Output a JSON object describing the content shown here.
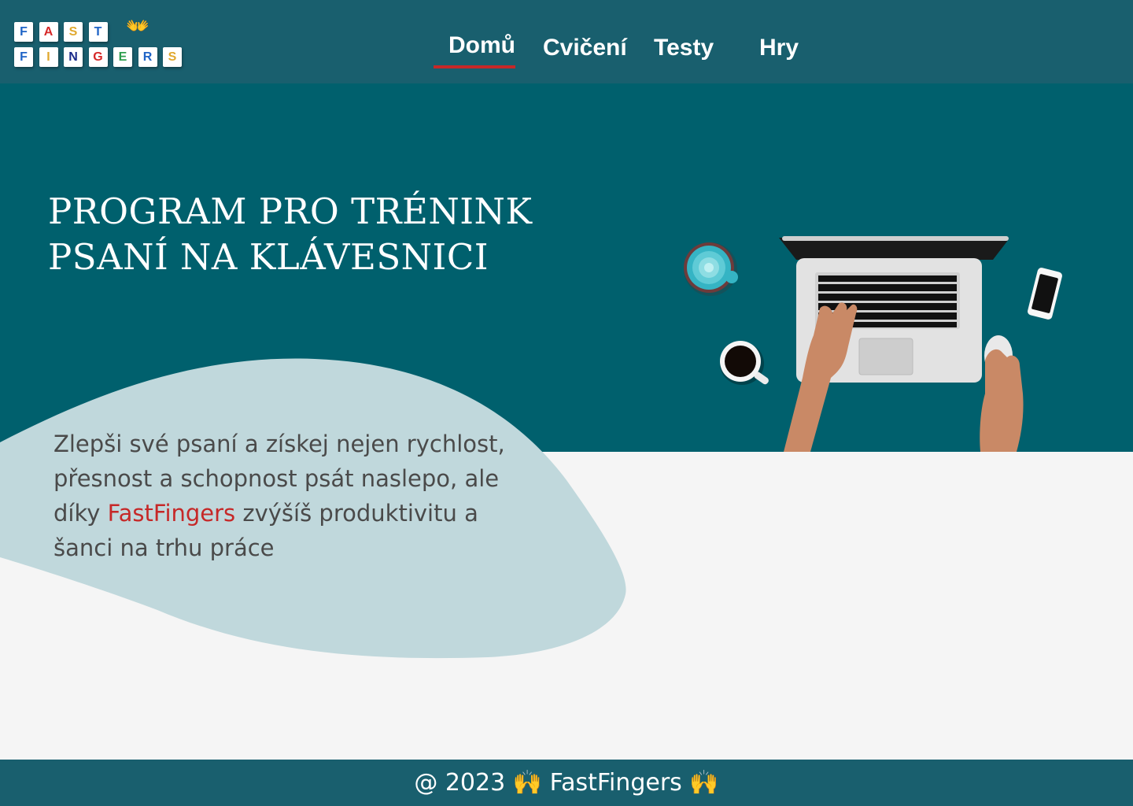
{
  "logo": {
    "row1": [
      {
        "letter": "F",
        "color": "#1e63c6"
      },
      {
        "letter": "A",
        "color": "#d62828"
      },
      {
        "letter": "S",
        "color": "#e0a82e"
      },
      {
        "letter": "T",
        "color": "#1e63c6"
      }
    ],
    "row2": [
      {
        "letter": "F",
        "color": "#1e63c6"
      },
      {
        "letter": "I",
        "color": "#e0a82e"
      },
      {
        "letter": "N",
        "color": "#1a2a8a"
      },
      {
        "letter": "G",
        "color": "#d62828"
      },
      {
        "letter": "E",
        "color": "#2e9e4e"
      },
      {
        "letter": "R",
        "color": "#1e63c6"
      },
      {
        "letter": "S",
        "color": "#e0a82e"
      }
    ],
    "emoji": "👐"
  },
  "nav": {
    "items": [
      {
        "label": "Domů",
        "active": true
      },
      {
        "label": "Cvičení",
        "active": false
      },
      {
        "label": "Testy",
        "active": false
      },
      {
        "label": "Hry",
        "active": false
      }
    ]
  },
  "hero": {
    "title_line1": "PROGRAM PRO TRÉNINK",
    "title_line2": "PSANÍ NA KLÁVESNICI",
    "lead_before": "Zlepši své psaní a získej nejen rychlost, přesnost a schopnost psát naslepo, ale díky ",
    "lead_brand": "FastFingers",
    "lead_after": " zvýšíš produktivitu a šanci na trhu práce",
    "illustration": "laptop-desk-illustration"
  },
  "footer": {
    "text": "@ 2023 🙌 FastFingers 🙌"
  },
  "colors": {
    "header_bg": "#195f6e",
    "hero_bg": "#00606d",
    "blob": "#c0d8dc",
    "accent_red": "#c62828",
    "page_bg": "#f5f5f5"
  }
}
